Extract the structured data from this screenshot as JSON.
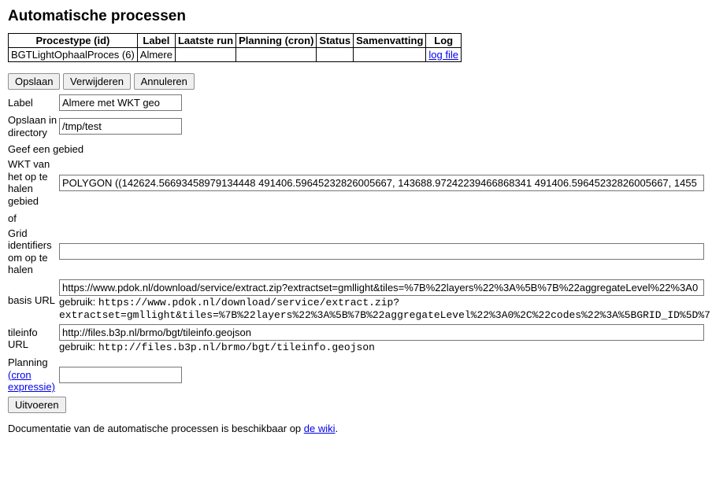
{
  "page_title": "Automatische processen",
  "table": {
    "headers": [
      "Procestype (id)",
      "Label",
      "Laatste run",
      "Planning (cron)",
      "Status",
      "Samenvatting",
      "Log"
    ],
    "row": {
      "procestype": "BGTLightOphaalProces (6)",
      "label": "Almere",
      "laatste_run": "",
      "planning": "",
      "status": "",
      "samenvatting": "",
      "log_link": "log file"
    }
  },
  "buttons": {
    "opslaan": "Opslaan",
    "verwijderen": "Verwijderen",
    "annuleren": "Annuleren",
    "uitvoeren": "Uitvoeren"
  },
  "form": {
    "label_label": "Label",
    "label_value": "Almere met WKT geo",
    "dir_label": "Opslaan in directory",
    "dir_value": "/tmp/test",
    "geef_gebied": "Geef een gebied",
    "wkt_label": "WKT van het op te halen gebied",
    "wkt_value": "POLYGON ((142624.56693458979134448 491406.59645232826005667, 143688.97242239466868341 491406.59645232826005667, 1455",
    "of_label": "of",
    "grid_label": "Grid identifiers om op te halen",
    "grid_value": "",
    "basisurl_label": "basis URL",
    "basisurl_value": "https://www.pdok.nl/download/service/extract.zip?extractset=gmllight&tiles=%7B%22layers%22%3A%5B%7B%22aggregateLevel%22%3A0",
    "basisurl_hint_pre": "gebruik: ",
    "basisurl_hint_code": "https://www.pdok.nl/download/service/extract.zip?extractset=gmllight&tiles=%7B%22layers%22%3A%5B%7B%22aggregateLevel%22%3A0%2C%22codes%22%3A%5BGRID_ID%5D%7",
    "tileinfo_label": "tileinfo URL",
    "tileinfo_value": "http://files.b3p.nl/brmo/bgt/tileinfo.geojson",
    "tileinfo_hint_pre": "gebruik: ",
    "tileinfo_hint_code": "http://files.b3p.nl/brmo/bgt/tileinfo.geojson",
    "planning_label_pre": "Planning ",
    "planning_cron_link": "(cron expressie)",
    "planning_value": ""
  },
  "footer": {
    "text_pre": "Documentatie van de automatische processen is beschikbaar op ",
    "link": "de wiki",
    "text_post": "."
  }
}
